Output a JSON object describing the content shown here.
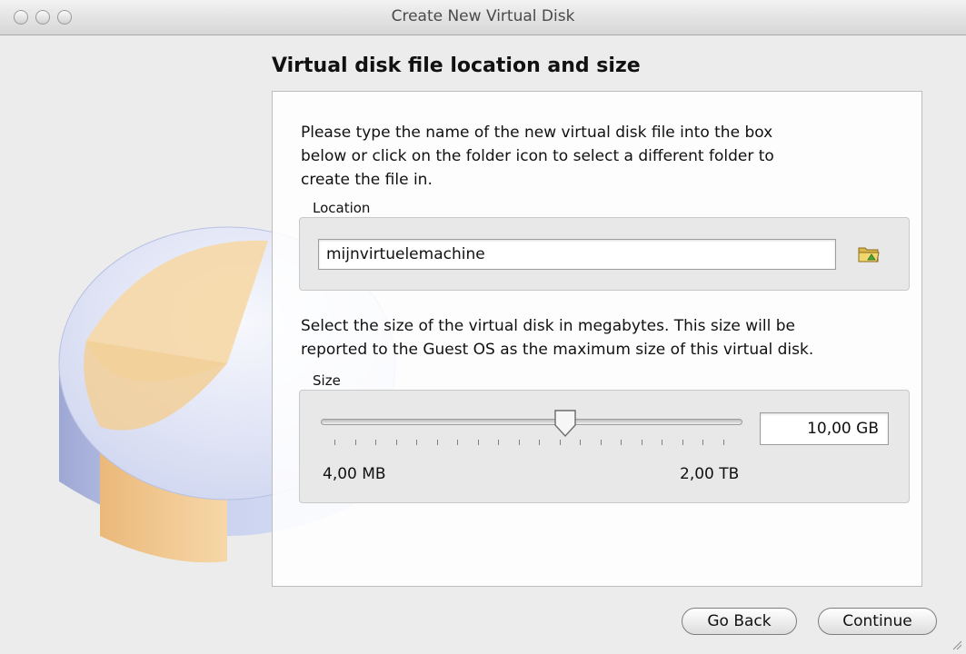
{
  "window": {
    "title": "Create New Virtual Disk",
    "controls": [
      "close-button",
      "minimize-button",
      "zoom-button"
    ]
  },
  "heading": "Virtual disk file location and size",
  "location": {
    "description": [
      "Please type the name of the new virtual disk file into the box",
      "below or click on the folder icon to select a different folder to",
      "create the file in."
    ],
    "group_label": "Location",
    "value": "mijnvirtuelemachine",
    "folder_icon": "folder-icon"
  },
  "size": {
    "description": [
      "Select the size of the virtual disk in megabytes. This size will be",
      "reported to the Guest OS as the maximum size of this virtual disk."
    ],
    "group_label": "Size",
    "slider_fraction": 0.58,
    "range_min": "4,00 MB",
    "range_max": "2,00 TB",
    "value": "10,00 GB"
  },
  "buttons": {
    "back": "Go Back",
    "continue": "Continue"
  },
  "colors": {
    "window_bg": "#ececec",
    "disk_orange": "#f3c98f",
    "disk_blue": "#c3cce9"
  }
}
